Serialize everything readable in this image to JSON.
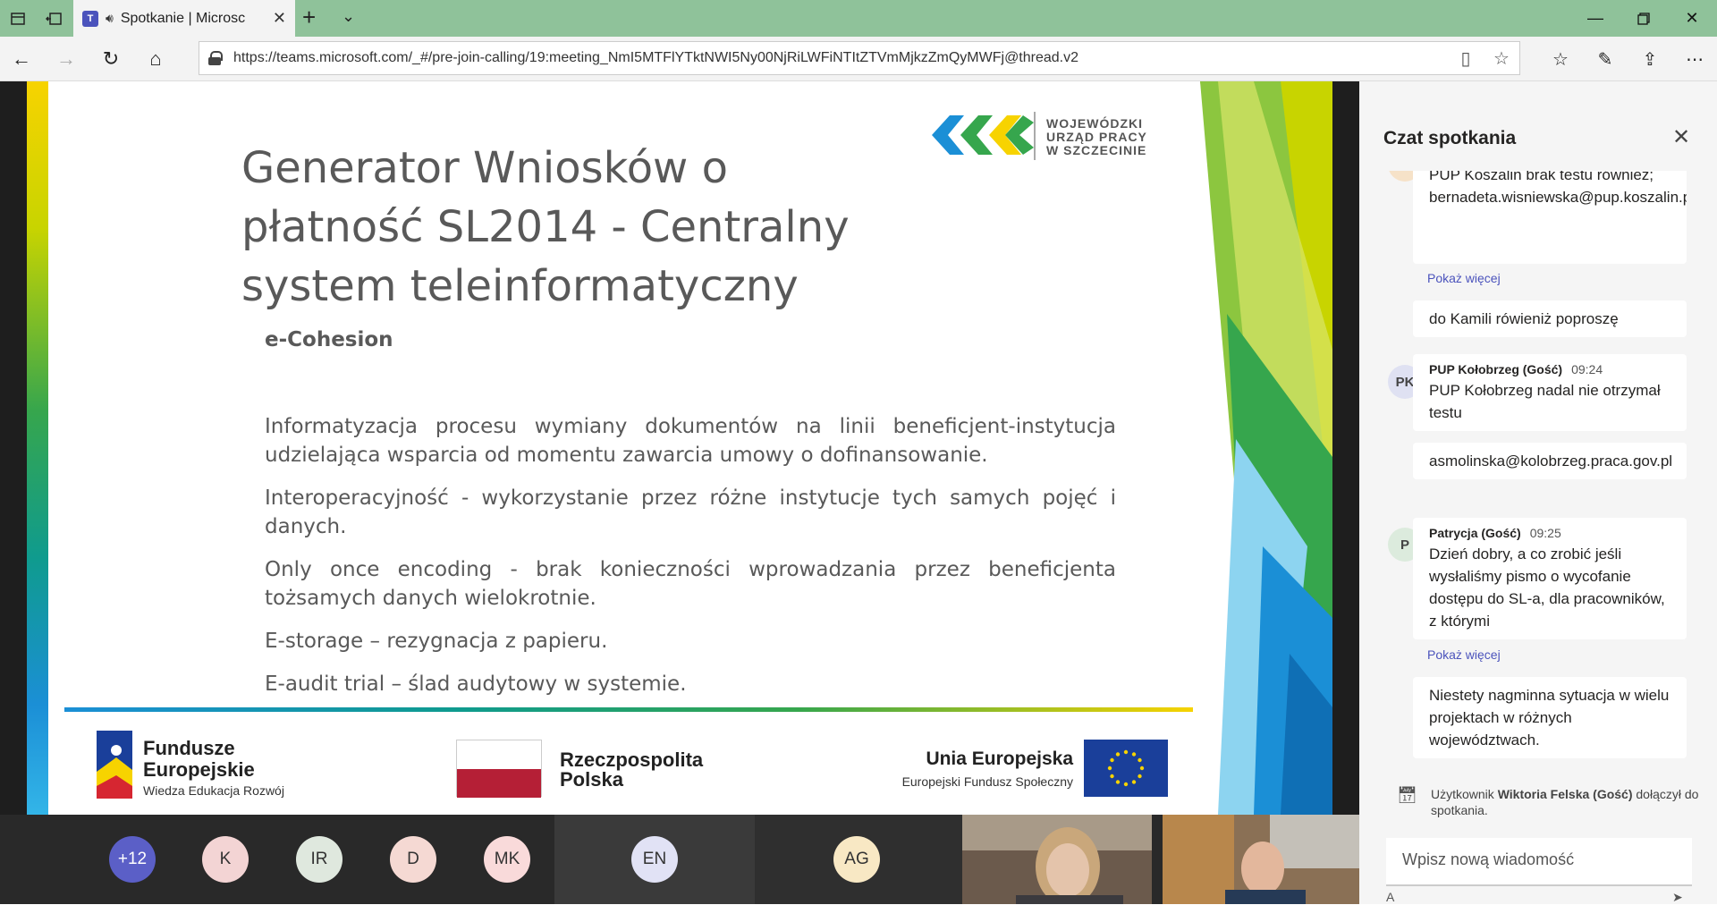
{
  "browser": {
    "tab_title": "Spotkanie | Microsc",
    "url": "https://teams.microsoft.com/_#/pre-join-calling/19:meeting_NmI5MTFlYTktNWI5Ny00NjRiLWFiNTItZTVmMjkzZmQyMWFj@thread.v2"
  },
  "slide": {
    "title": "Generator Wniosków o płatność SL2014 - Centralny system teleinformatyczny",
    "subtitle": "e-Cohesion",
    "paragraphs": [
      "Informatyzacja procesu wymiany dokumentów na linii beneficjent-instytucja udzielająca wsparcia od momentu zawarcia umowy o dofinansowanie.",
      "Interoperacyjność - wykorzystanie przez różne instytucje tych samych pojęć i danych.",
      "Only once encoding - brak konieczności wprowadzania przez beneficjenta tożsamych danych wielokrotnie.",
      "E-storage – rezygnacja z papieru.",
      "E-audit trial – ślad audytowy w systemie."
    ],
    "wup_logo_text": [
      "WOJEWÓDZKI",
      "URZĄD PRACY",
      "W SZCZECINIE"
    ],
    "footer": {
      "fe_name_line1": "Fundusze",
      "fe_name_line2": "Europejskie",
      "fe_program": "Wiedza Edukacja Rozwój",
      "rp_line1": "Rzeczpospolita",
      "rp_line2": "Polska",
      "ue_name": "Unia Europejska",
      "ue_fund": "Europejski Fundusz Społeczny"
    }
  },
  "participants": [
    {
      "initials": "+12",
      "color": "#5b5fc7",
      "text_color": "#ffffff"
    },
    {
      "initials": "K",
      "color": "#f3d4d4"
    },
    {
      "initials": "IR",
      "color": "#dfe8de"
    },
    {
      "initials": "D",
      "color": "#f5d9d3"
    },
    {
      "initials": "MK",
      "color": "#f9dada"
    },
    {
      "initials": "EN",
      "color": "#e1e2f5"
    },
    {
      "initials": "AG",
      "color": "#f8e8c4"
    }
  ],
  "chat": {
    "title": "Czat spotkania",
    "messages": [
      {
        "text": "PUP Koszalin brak testu również; bernadeta.wisniewska@pup.koszalin.pl,",
        "more": "Pokaż więcej"
      },
      {
        "text": "do Kamili rówieniż poproszę"
      },
      {
        "author": "PUP Kołobrzeg (Gość)",
        "time": "09:24",
        "initials": "PK",
        "text": "PUP Kołobrzeg nadal nie otrzymał testu"
      },
      {
        "text": "asmolinska@kolobrzeg.praca.gov.pl"
      },
      {
        "author": "Patrycja (Gość)",
        "time": "09:25",
        "initials": "P",
        "text": "Dzień dobry, a co zrobić jeśli wysłaliśmy pismo o wycofanie dostępu do SL-a, dla pracowników, z którymi",
        "more": "Pokaż więcej"
      },
      {
        "text": "Niestety nagminna sytuacja w wielu projektach w różnych województwach."
      }
    ],
    "system_prefix": "Użytkownik",
    "system_user": "Wiktoria Felska (Gość)",
    "system_suffix": "dołączył do spotkania.",
    "compose_placeholder": "Wpisz nową wiadomość"
  }
}
